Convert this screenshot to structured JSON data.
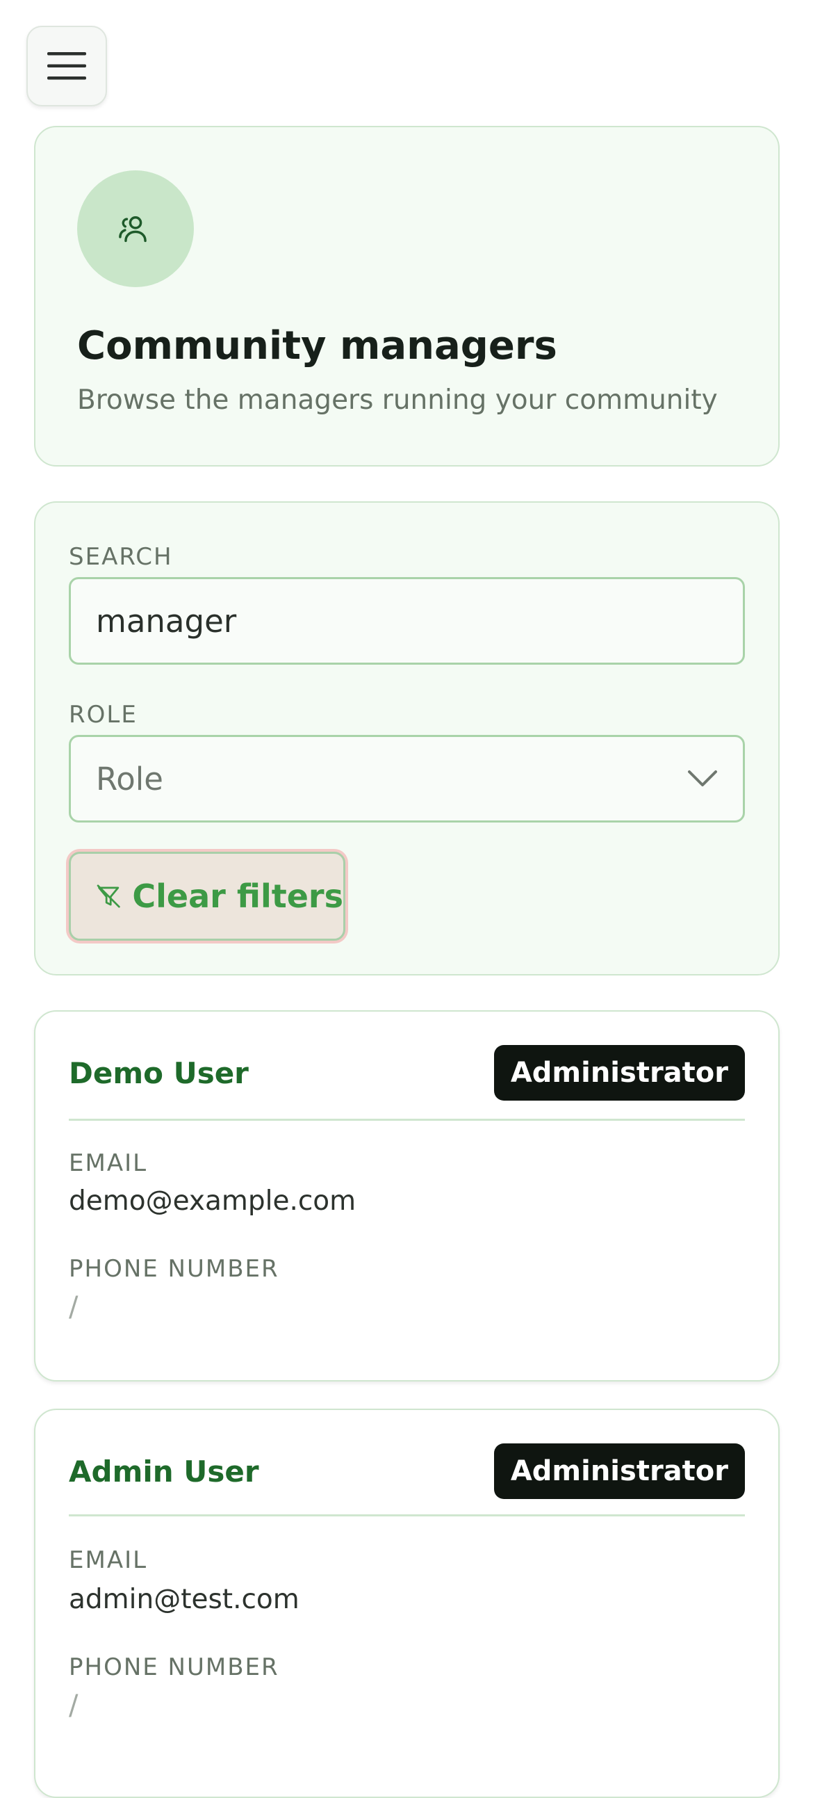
{
  "header": {
    "title": "Community managers",
    "subtitle": "Browse the managers running your community"
  },
  "filters": {
    "search_label": "SEARCH",
    "search_value": "manager",
    "role_label": "ROLE",
    "role_value": "Role",
    "clear_label": "Clear filters"
  },
  "users": [
    {
      "name": "Demo User",
      "role": "Administrator",
      "email_label": "EMAIL",
      "email": "demo@example.com",
      "phone_label": "PHONE NUMBER",
      "phone": "/"
    },
    {
      "name": "Admin User",
      "role": "Administrator",
      "email_label": "EMAIL",
      "email": "admin@test.com",
      "phone_label": "PHONE NUMBER",
      "phone": "/"
    }
  ],
  "icons": {
    "menu": "hamburger-menu-icon",
    "header": "users-icon",
    "select": "chevron-down-icon",
    "clear": "filter-off-icon"
  },
  "colors": {
    "accent": "#3d9a45",
    "name": "#1e6a2a",
    "badge": "#0f1510"
  }
}
